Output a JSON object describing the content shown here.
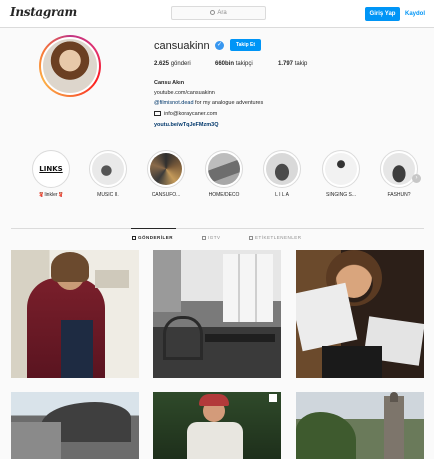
{
  "topbar": {
    "logo": "Instagram",
    "search_placeholder": "Ara",
    "login_label": "Giriş Yap",
    "signup_label": "Kaydol"
  },
  "profile": {
    "username": "cansuakinn",
    "follow_label": "Takip Et",
    "posts_count": "2.625",
    "posts_label": "gönderi",
    "followers_count": "660bin",
    "followers_label": "takipçi",
    "following_count": "1.797",
    "following_label": "takip",
    "full_name": "Cansu Akın",
    "bio_line1": "youtube.com/cansuakinn",
    "bio_mention": "@filmisnot.dead",
    "bio_line2_rest": " for my analogue adventures",
    "bio_email": "info@koraycaner.com",
    "website": "youtu.be/wTqJeFMzm3Q"
  },
  "highlights": [
    {
      "label": "🧣linkler🧣",
      "icon": "links-icon",
      "color": "#ffffff"
    },
    {
      "label": "MUSIC II.",
      "icon": "gramophone-icon",
      "color": "#e9e9e9"
    },
    {
      "label": "CANSUFO...",
      "icon": "photo-collage-icon",
      "color": "#3a3a3a"
    },
    {
      "label": "HOME/DECO",
      "icon": "home-icon",
      "color": "#8c8c8c"
    },
    {
      "label": "L I L A",
      "icon": "cat-icon",
      "color": "#d9d9d9"
    },
    {
      "label": "SINGING S...",
      "icon": "microphone-icon",
      "color": "#f2f2f2"
    },
    {
      "label": "FASHUN?",
      "icon": "handbag-icon",
      "color": "#e6e6e6"
    }
  ],
  "tabs": [
    {
      "label": "GÖNDERİLER",
      "active": true
    },
    {
      "label": "IGTV",
      "active": false
    },
    {
      "label": "ETİKETLENENLER",
      "active": false
    }
  ],
  "colors": {
    "accent": "#0095f6",
    "verified": "#3897f0",
    "link": "#00376b"
  }
}
